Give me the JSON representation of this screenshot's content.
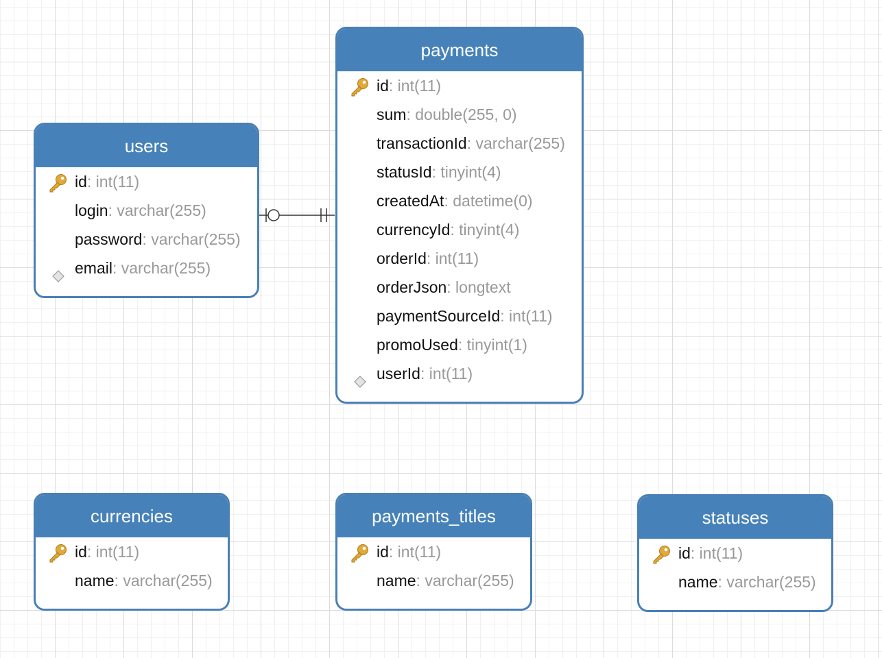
{
  "colors": {
    "header": "#4682b9",
    "border": "#4a7fb5",
    "key_icon": "#e0a93a",
    "field_name": "#111111",
    "field_type": "#999999",
    "grid": "#dcdcdc"
  },
  "tables": {
    "users": {
      "name": "users",
      "fields": [
        {
          "name": "id",
          "sep": ":",
          "type": " int(11)",
          "icon": "primary-key-icon"
        },
        {
          "name": "login",
          "sep": ":",
          "type": " varchar(255)",
          "icon": ""
        },
        {
          "name": "password",
          "sep": ":",
          "type": " varchar(255)",
          "icon": ""
        },
        {
          "name": "email",
          "sep": ":",
          "type": " varchar(255)",
          "icon": "foreign-key-icon"
        }
      ]
    },
    "payments": {
      "name": "payments",
      "fields": [
        {
          "name": "id",
          "sep": ":",
          "type": " int(11)",
          "icon": "primary-key-icon"
        },
        {
          "name": "sum",
          "sep": ":",
          "type": " double(255, 0)",
          "icon": ""
        },
        {
          "name": "transactionId",
          "sep": ":",
          "type": " varchar(255)",
          "icon": ""
        },
        {
          "name": "statusId",
          "sep": ":",
          "type": " tinyint(4)",
          "icon": ""
        },
        {
          "name": "createdAt",
          "sep": ":",
          "type": " datetime(0)",
          "icon": ""
        },
        {
          "name": "currencyId",
          "sep": ":",
          "type": " tinyint(4)",
          "icon": ""
        },
        {
          "name": "orderId",
          "sep": ":",
          "type": " int(11)",
          "icon": ""
        },
        {
          "name": "orderJson",
          "sep": ":",
          "type": " longtext",
          "icon": ""
        },
        {
          "name": "paymentSourceId",
          "sep": ":",
          "type": " int(11)",
          "icon": ""
        },
        {
          "name": "promoUsed",
          "sep": ":",
          "type": " tinyint(1)",
          "icon": ""
        },
        {
          "name": "userId",
          "sep": ":",
          "type": " int(11)",
          "icon": "foreign-key-icon"
        }
      ]
    },
    "currencies": {
      "name": "currencies",
      "fields": [
        {
          "name": "id",
          "sep": ":",
          "type": " int(11)",
          "icon": "primary-key-icon"
        },
        {
          "name": "name",
          "sep": ":",
          "type": " varchar(255)",
          "icon": ""
        }
      ]
    },
    "payments_titles": {
      "name": "payments_titles",
      "fields": [
        {
          "name": "id",
          "sep": ":",
          "type": " int(11)",
          "icon": "primary-key-icon"
        },
        {
          "name": "name",
          "sep": ":",
          "type": " varchar(255)",
          "icon": ""
        }
      ]
    },
    "statuses": {
      "name": "statuses",
      "fields": [
        {
          "name": "id",
          "sep": ":",
          "type": " int(11)",
          "icon": "primary-key-icon"
        },
        {
          "name": "name",
          "sep": ":",
          "type": " varchar(255)",
          "icon": ""
        }
      ]
    }
  },
  "relations": [
    {
      "from": "users",
      "to": "payments",
      "from_end": "zero-or-one",
      "to_end": "one-and-only-one"
    }
  ]
}
